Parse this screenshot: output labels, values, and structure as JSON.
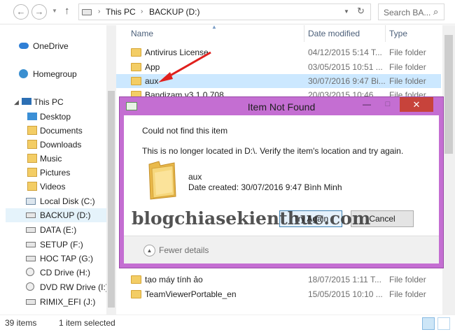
{
  "address": {
    "crumbs": [
      "This PC",
      "BACKUP (D:)"
    ],
    "search_placeholder": "Search BA..."
  },
  "nav": {
    "items": [
      {
        "label": "OneDrive",
        "icon": "cloud-icon"
      },
      {
        "label": "Homegroup",
        "icon": "homegroup-icon"
      },
      {
        "label": "This PC",
        "icon": "computer-icon"
      },
      {
        "label": "Desktop",
        "icon": "folder-icon"
      },
      {
        "label": "Documents",
        "icon": "folder-icon"
      },
      {
        "label": "Downloads",
        "icon": "folder-icon"
      },
      {
        "label": "Music",
        "icon": "folder-icon"
      },
      {
        "label": "Pictures",
        "icon": "folder-icon"
      },
      {
        "label": "Videos",
        "icon": "folder-icon"
      },
      {
        "label": "Local Disk (C:)",
        "icon": "drive-icon"
      },
      {
        "label": "BACKUP (D:)",
        "icon": "drive-icon"
      },
      {
        "label": "DATA (E:)",
        "icon": "drive-icon"
      },
      {
        "label": "SETUP (F:)",
        "icon": "drive-icon"
      },
      {
        "label": "HOC TAP (G:)",
        "icon": "drive-icon"
      },
      {
        "label": "CD Drive (H:)",
        "icon": "cd-drive-icon"
      },
      {
        "label": "DVD RW Drive (I:) I",
        "icon": "dvd-drive-icon"
      },
      {
        "label": "RIMIX_EFI (J:)",
        "icon": "drive-icon"
      }
    ]
  },
  "columns": {
    "name": "Name",
    "date": "Date modified",
    "type": "Type"
  },
  "files_top": [
    {
      "name": "Antivirus License",
      "date": "04/12/2015 5:14 T...",
      "type": "File folder"
    },
    {
      "name": "App",
      "date": "03/05/2015 10:51 ...",
      "type": "File folder"
    },
    {
      "name": "aux",
      "date": "30/07/2016 9:47 Bi...",
      "type": "File folder"
    },
    {
      "name": "Bandizam v3.1.0.708",
      "date": "20/03/2015 10:46 ...",
      "type": "File folder"
    }
  ],
  "files_bottom": [
    {
      "name": "tạo máy tính ảo",
      "date": "18/07/2015 1:11 T...",
      "type": "File folder"
    },
    {
      "name": "TeamViewerPortable_en",
      "date": "15/05/2015 10:10 ...",
      "type": "File folder"
    }
  ],
  "status": {
    "items": "39 items",
    "selected": "1 item selected"
  },
  "dialog": {
    "title": "Item Not Found",
    "heading": "Could not find this item",
    "message": "This is no longer located in D:\\. Verify the item's location and try again.",
    "item_name": "aux",
    "item_date": "Date created: 30/07/2016 9:47 Bình Minh",
    "try_again": "Try Again",
    "cancel": "Cancel",
    "fewer_details": "Fewer details",
    "accent": "#c46ed2",
    "close_glyph": "✕",
    "min_glyph": "—",
    "max_glyph": "□"
  },
  "watermark": "blogchiasekienthuc.com",
  "colors": {
    "selection": "#cce8ff",
    "folder": "#f3cd65",
    "close": "#c7433b"
  }
}
